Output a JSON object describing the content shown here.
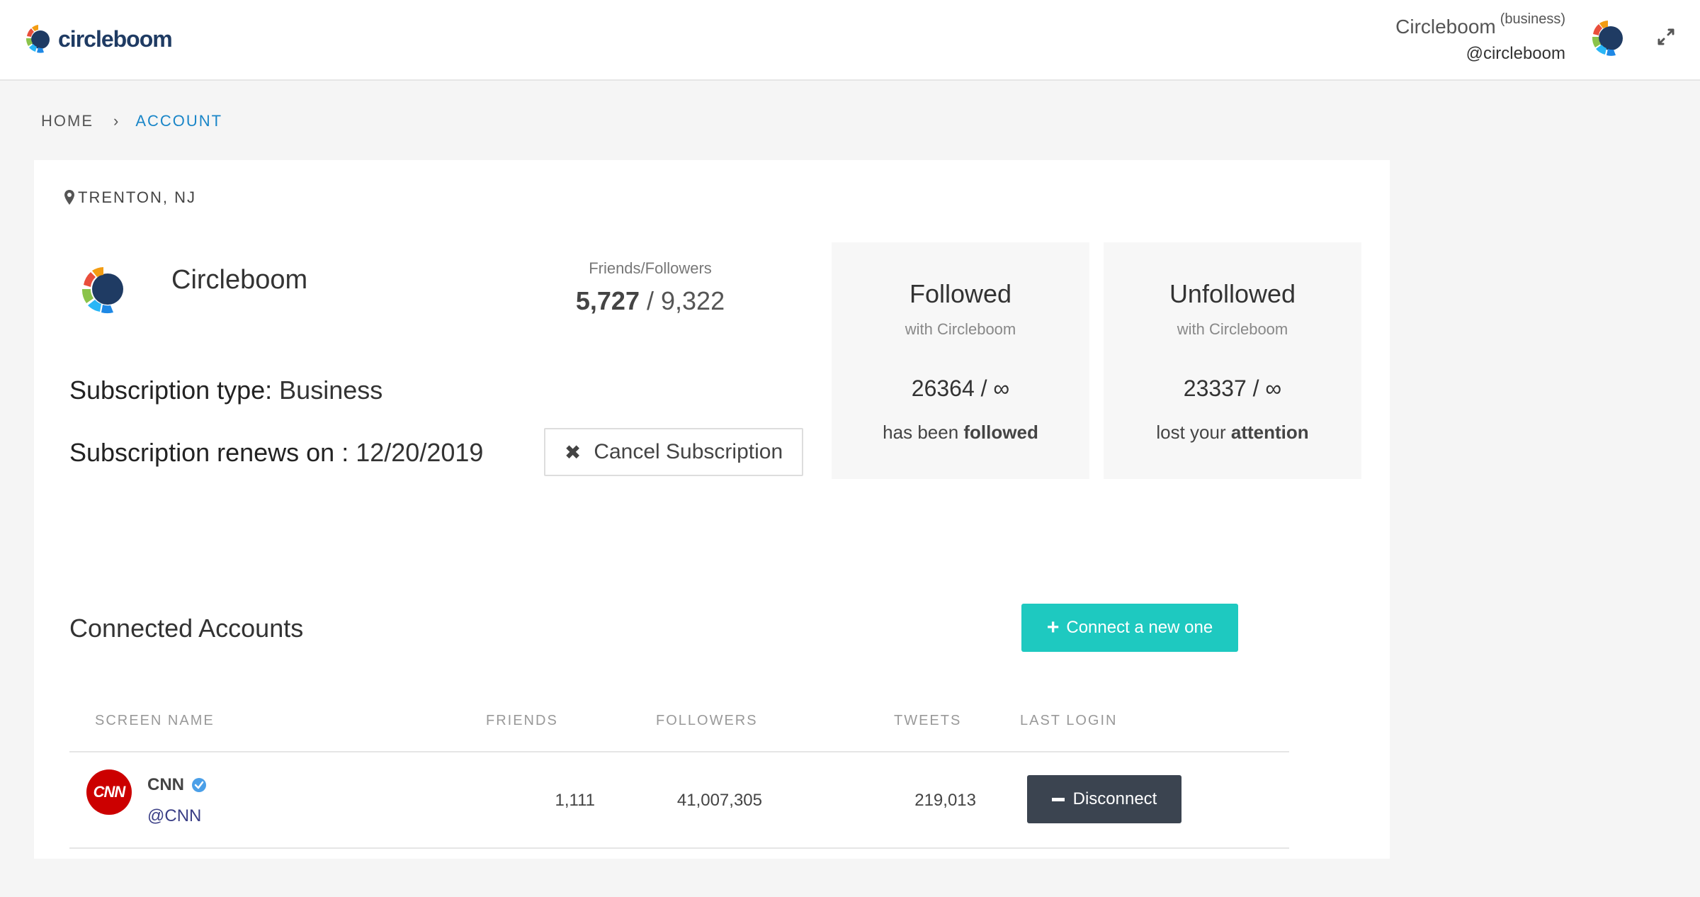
{
  "header": {
    "logo_text": "circleboom",
    "user_name": "Circleboom",
    "user_tier": "(business)",
    "user_handle": "@circleboom"
  },
  "breadcrumb": {
    "home": "HOME",
    "current": "ACCOUNT"
  },
  "profile": {
    "location": "TRENTON, NJ",
    "name": "Circleboom",
    "ff_label": "Friends/Followers",
    "friends": "5,727",
    "followers": "/ 9,322",
    "subscription_type_label": "Subscription type:",
    "subscription_type": "Business",
    "renews_label": "Subscription renews on :",
    "renews_date": "12/20/2019",
    "cancel_label": "Cancel Subscription"
  },
  "stats": {
    "followed": {
      "title": "Followed",
      "subtitle": "with Circleboom",
      "count": "26364 / ∞",
      "desc_prefix": "has been",
      "desc_bold": "followed"
    },
    "unfollowed": {
      "title": "Unfollowed",
      "subtitle": "with Circleboom",
      "count": "23337 / ∞",
      "desc_prefix": "lost your",
      "desc_bold": "attention"
    }
  },
  "connected": {
    "title": "Connected Accounts",
    "connect_label": "Connect a new one",
    "columns": [
      "SCREEN NAME",
      "FRIENDS",
      "FOLLOWERS",
      "TWEETS",
      "LAST LOGIN"
    ],
    "rows": [
      {
        "logo_text": "CNN",
        "name": "CNN",
        "handle": "@CNN",
        "friends": "1,111",
        "followers": "41,007,305",
        "tweets": "219,013",
        "action": "Disconnect"
      }
    ]
  },
  "colors": {
    "accent_teal": "#1ec9c0",
    "link_blue": "#1a86c8",
    "dark_button": "#3b4450",
    "cnn_red": "#cc0000",
    "verified_blue": "#4a9fe8"
  },
  "icons": {
    "logo": "circleboom-logo",
    "location": "map-pin-icon",
    "verified": "verified-badge-icon",
    "expand": "expand-icon",
    "cancel": "times-icon",
    "connect": "plus-icon",
    "disconnect": "minus-icon",
    "breadcrumb_sep": "chevron-right-icon"
  }
}
